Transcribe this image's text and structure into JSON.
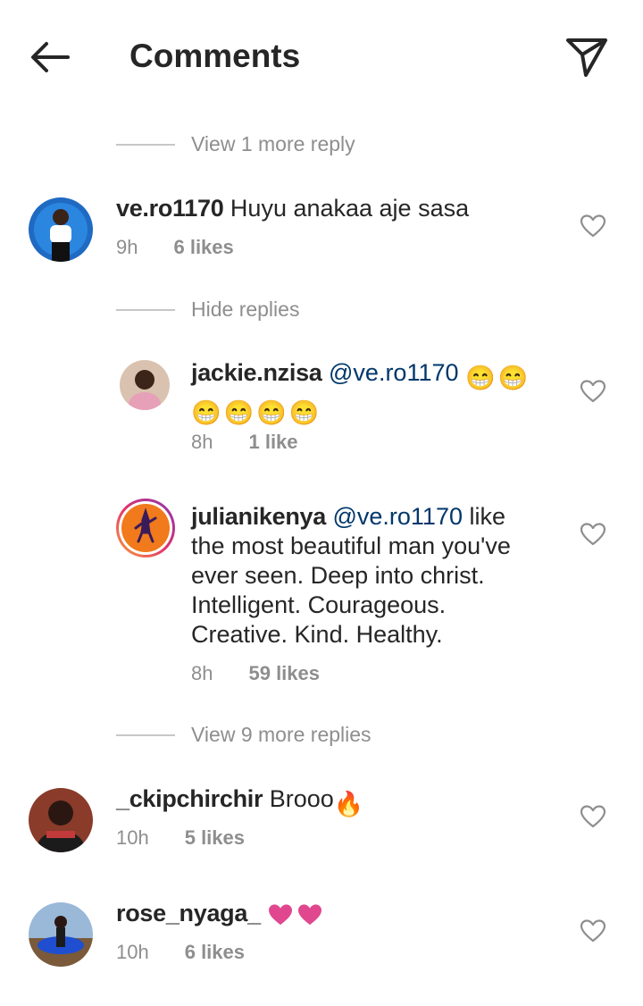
{
  "header": {
    "title": "Comments",
    "back_icon": "arrow-left-icon",
    "share_icon": "paper-plane-icon"
  },
  "toggles": {
    "view_more_1": "View 1 more reply",
    "hide_replies": "Hide replies",
    "view_more_9": "View 9 more replies"
  },
  "comments": [
    {
      "username": "ve.ro1170",
      "text": " Huyu anakaa aje sasa",
      "time": "9h",
      "likes": "6 likes"
    },
    {
      "username": "jackie.nzisa",
      "mention": "@ve.ro1170",
      "text": "",
      "emoji": "😁",
      "time": "8h",
      "likes": "1 like"
    },
    {
      "username": "julianikenya",
      "mention": "@ve.ro1170",
      "text": " like the most beautiful man you've ever seen. Deep into christ. Intelligent.  Courageous. Creative. Kind. Healthy.",
      "time": "8h",
      "likes": "59 likes"
    },
    {
      "username": "_ckipchirchir",
      "text": " Brooo",
      "emoji": "🔥",
      "time": "10h",
      "likes": "5 likes"
    },
    {
      "username": "rose_nyaga_",
      "text": "",
      "emoji": "❤️",
      "time": "10h",
      "likes": "6 likes"
    }
  ],
  "colors": {
    "text": "#262626",
    "secondary": "#8e8e8e",
    "mention": "#00376b",
    "heart_pink": "#e0478f"
  }
}
